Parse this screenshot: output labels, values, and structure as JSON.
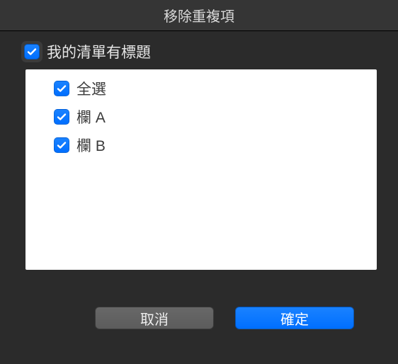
{
  "dialog": {
    "title": "移除重複項"
  },
  "header": {
    "checkbox_checked": true,
    "label": "我的清單有標題"
  },
  "list": {
    "items": [
      {
        "label": "全選",
        "checked": true
      },
      {
        "label": "欄 A",
        "checked": true
      },
      {
        "label": "欄 B",
        "checked": true
      }
    ]
  },
  "buttons": {
    "cancel": "取消",
    "ok": "確定"
  },
  "colors": {
    "accent": "#006fff"
  }
}
